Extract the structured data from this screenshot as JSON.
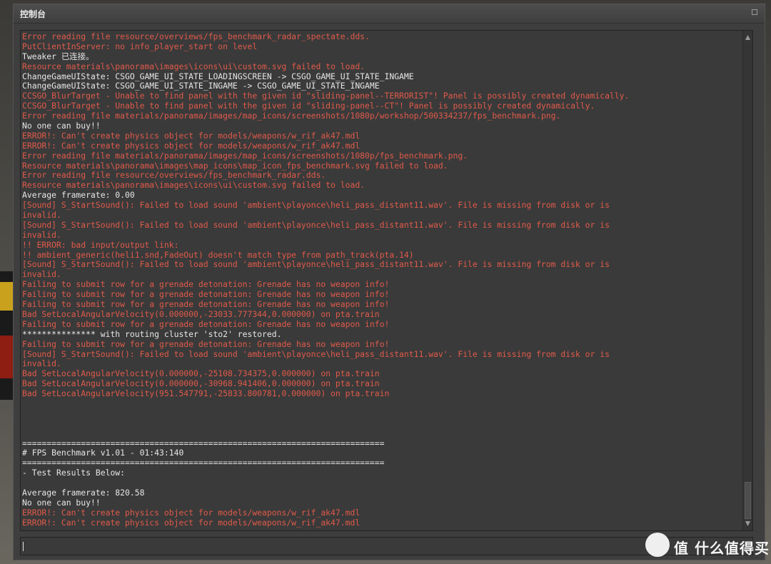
{
  "window": {
    "title": "控制台"
  },
  "console": {
    "lines": [
      {
        "text": "Error reading file resource/overviews/fps_benchmark_radar_spectate.dds.",
        "color": "red"
      },
      {
        "text": "PutClientInServer: no info_player_start on level",
        "color": "red"
      },
      {
        "text": "Tweaker 已连接。",
        "color": "white"
      },
      {
        "text": "Resource materials\\panorama\\images\\icons\\ui\\custom.svg failed to load.",
        "color": "red"
      },
      {
        "text": "ChangeGameUIState: CSGO_GAME_UI_STATE_LOADINGSCREEN -> CSGO_GAME_UI_STATE_INGAME",
        "color": "white"
      },
      {
        "text": "ChangeGameUIState: CSGO_GAME_UI_STATE_INGAME -> CSGO_GAME_UI_STATE_INGAME",
        "color": "white"
      },
      {
        "text": "CCSGO_BlurTarget - Unable to find panel with the given id \"sliding-panel--TERRORIST\"! Panel is possibly created dynamically.",
        "color": "red"
      },
      {
        "text": "CCSGO_BlurTarget - Unable to find panel with the given id \"sliding-panel--CT\"! Panel is possibly created dynamically.",
        "color": "red"
      },
      {
        "text": "Error reading file materials/panorama/images/map_icons/screenshots/1080p/workshop/500334237/fps_benchmark.png.",
        "color": "red"
      },
      {
        "text": "No one can buy!!",
        "color": "white"
      },
      {
        "text": "ERROR!: Can't create physics object for models/weapons/w_rif_ak47.mdl",
        "color": "red"
      },
      {
        "text": "ERROR!: Can't create physics object for models/weapons/w_rif_ak47.mdl",
        "color": "red"
      },
      {
        "text": "Error reading file materials/panorama/images/map_icons/screenshots/1080p/fps_benchmark.png.",
        "color": "red"
      },
      {
        "text": "Resource materials\\panorama\\images\\map_icons\\map_icon_fps_benchmark.svg failed to load.",
        "color": "red"
      },
      {
        "text": "Error reading file resource/overviews/fps_benchmark_radar.dds.",
        "color": "red"
      },
      {
        "text": "Resource materials\\panorama\\images\\icons\\ui\\custom.svg failed to load.",
        "color": "red"
      },
      {
        "text": "Average framerate: 0.00",
        "color": "white"
      },
      {
        "text": "[Sound] S_StartSound(): Failed to load sound 'ambient\\playonce\\heli_pass_distant11.wav'. File is missing from disk or is",
        "color": "red"
      },
      {
        "text": "invalid.",
        "color": "red"
      },
      {
        "text": "[Sound] S_StartSound(): Failed to load sound 'ambient\\playonce\\heli_pass_distant11.wav'. File is missing from disk or is",
        "color": "red"
      },
      {
        "text": "invalid.",
        "color": "red"
      },
      {
        "text": "!! ERROR: bad input/output link:",
        "color": "red"
      },
      {
        "text": "!! ambient_generic(heli1.snd,FadeOut) doesn't match type from path_track(pta.14)",
        "color": "red"
      },
      {
        "text": "[Sound] S_StartSound(): Failed to load sound 'ambient\\playonce\\heli_pass_distant11.wav'. File is missing from disk or is",
        "color": "red"
      },
      {
        "text": "invalid.",
        "color": "red"
      },
      {
        "text": "Failing to submit row for a grenade detonation: Grenade has no weapon info!",
        "color": "red"
      },
      {
        "text": "Failing to submit row for a grenade detonation: Grenade has no weapon info!",
        "color": "red"
      },
      {
        "text": "Failing to submit row for a grenade detonation: Grenade has no weapon info!",
        "color": "red"
      },
      {
        "text": "Bad SetLocalAngularVelocity(0.000000,-23033.777344,0.000000) on pta.train",
        "color": "red"
      },
      {
        "text": "Failing to submit row for a grenade detonation: Grenade has no weapon info!",
        "color": "red"
      },
      {
        "text": "*************** with routing cluster 'sto2' restored.",
        "color": "white"
      },
      {
        "text": "Failing to submit row for a grenade detonation: Grenade has no weapon info!",
        "color": "red"
      },
      {
        "text": "[Sound] S_StartSound(): Failed to load sound 'ambient\\playonce\\heli_pass_distant11.wav'. File is missing from disk or is",
        "color": "red"
      },
      {
        "text": "invalid.",
        "color": "red"
      },
      {
        "text": "Bad SetLocalAngularVelocity(0.000000,-25108.734375,0.000000) on pta.train",
        "color": "red"
      },
      {
        "text": "Bad SetLocalAngularVelocity(0.000000,-30968.941406,0.000000) on pta.train",
        "color": "red"
      },
      {
        "text": "Bad SetLocalAngularVelocity(951.547791,-25833.800781,0.000000) on pta.train",
        "color": "red"
      },
      {
        "text": "",
        "color": "white"
      },
      {
        "text": "",
        "color": "white"
      },
      {
        "text": "",
        "color": "white"
      },
      {
        "text": "",
        "color": "white"
      },
      {
        "text": "==========================================================================",
        "color": "white"
      },
      {
        "text": "# FPS Benchmark v1.01 - 01:43:140",
        "color": "white"
      },
      {
        "text": "==========================================================================",
        "color": "white"
      },
      {
        "text": "- Test Results Below:",
        "color": "white"
      },
      {
        "text": "",
        "color": "white"
      },
      {
        "text": "Average framerate: 820.58",
        "color": "white"
      },
      {
        "text": "No one can buy!!",
        "color": "white"
      },
      {
        "text": "ERROR!: Can't create physics object for models/weapons/w_rif_ak47.mdl",
        "color": "red"
      },
      {
        "text": "ERROR!: Can't create physics object for models/weapons/w_rif_ak47.mdl",
        "color": "red"
      }
    ]
  },
  "input": {
    "value": "",
    "placeholder": ""
  },
  "watermark": {
    "text": "值 什么值得买"
  },
  "colors": {
    "error": "#e05a4a",
    "normal": "#e6e6e6",
    "panel": "#3a3a3a",
    "titlebar": "#454545"
  }
}
